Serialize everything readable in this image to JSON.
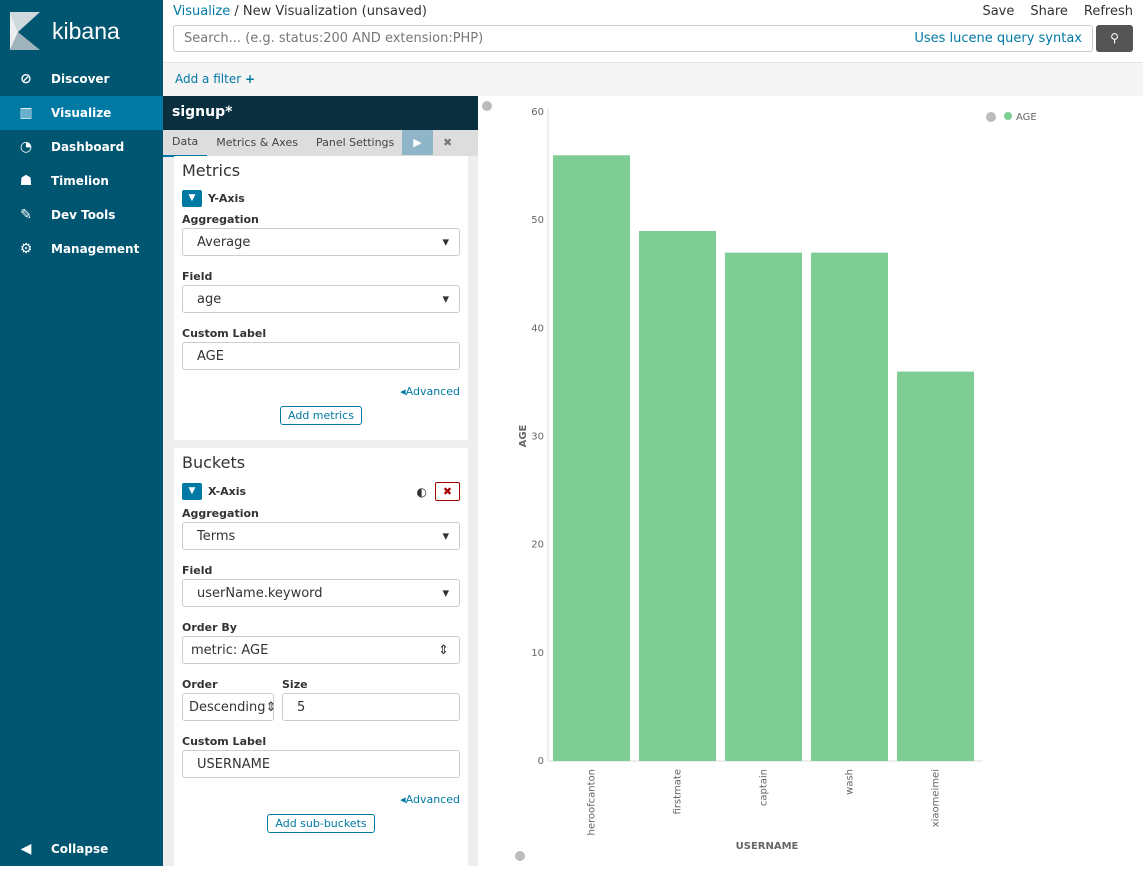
{
  "sidebar": {
    "brand": "kibana",
    "items": [
      {
        "label": "Discover",
        "icon": "compass-icon"
      },
      {
        "label": "Visualize",
        "icon": "bar-chart-icon"
      },
      {
        "label": "Dashboard",
        "icon": "dashboard-icon"
      },
      {
        "label": "Timelion",
        "icon": "timelion-icon"
      },
      {
        "label": "Dev Tools",
        "icon": "wrench-icon"
      },
      {
        "label": "Management",
        "icon": "gear-icon"
      }
    ],
    "collapse": "Collapse"
  },
  "header": {
    "breadcrumb_link": "Visualize",
    "breadcrumb_sep": "/",
    "title": "New Visualization (unsaved)",
    "save": "Save",
    "share": "Share",
    "refresh": "Refresh",
    "search_placeholder": "Search... (e.g. status:200 AND extension:PHP)",
    "search_hint": "Uses lucene query syntax",
    "add_filter": "Add a filter"
  },
  "editor": {
    "index": "signup*",
    "tabs": [
      "Data",
      "Metrics & Axes",
      "Panel Settings"
    ],
    "metrics": {
      "title": "Metrics",
      "agg_title": "Y-Axis",
      "aggregation_label": "Aggregation",
      "aggregation": "Average",
      "field_label": "Field",
      "field": "age",
      "custom_label_label": "Custom Label",
      "custom_label": "AGE",
      "advanced": "Advanced",
      "add": "Add metrics"
    },
    "buckets": {
      "title": "Buckets",
      "agg_title": "X-Axis",
      "aggregation_label": "Aggregation",
      "aggregation": "Terms",
      "field_label": "Field",
      "field": "userName.keyword",
      "order_by_label": "Order By",
      "order_by": "metric: AGE",
      "order_label": "Order",
      "order": "Descending",
      "size_label": "Size",
      "size": "5",
      "custom_label_label": "Custom Label",
      "custom_label": "USERNAME",
      "advanced": "Advanced",
      "add": "Add sub-buckets"
    }
  },
  "chart_data": {
    "type": "bar",
    "categories": [
      "heroofcanton",
      "firstmate",
      "captain",
      "wash",
      "xiaomeimei"
    ],
    "values": [
      56,
      49,
      47,
      47,
      36
    ],
    "xlabel": "USERNAME",
    "ylabel": "AGE",
    "ylim": [
      0,
      60
    ],
    "yticks": [
      "0",
      "10",
      "20",
      "30",
      "40",
      "50",
      "60"
    ],
    "legend": {
      "label": "AGE",
      "position": "top-right"
    },
    "color": "#7dcd94"
  }
}
